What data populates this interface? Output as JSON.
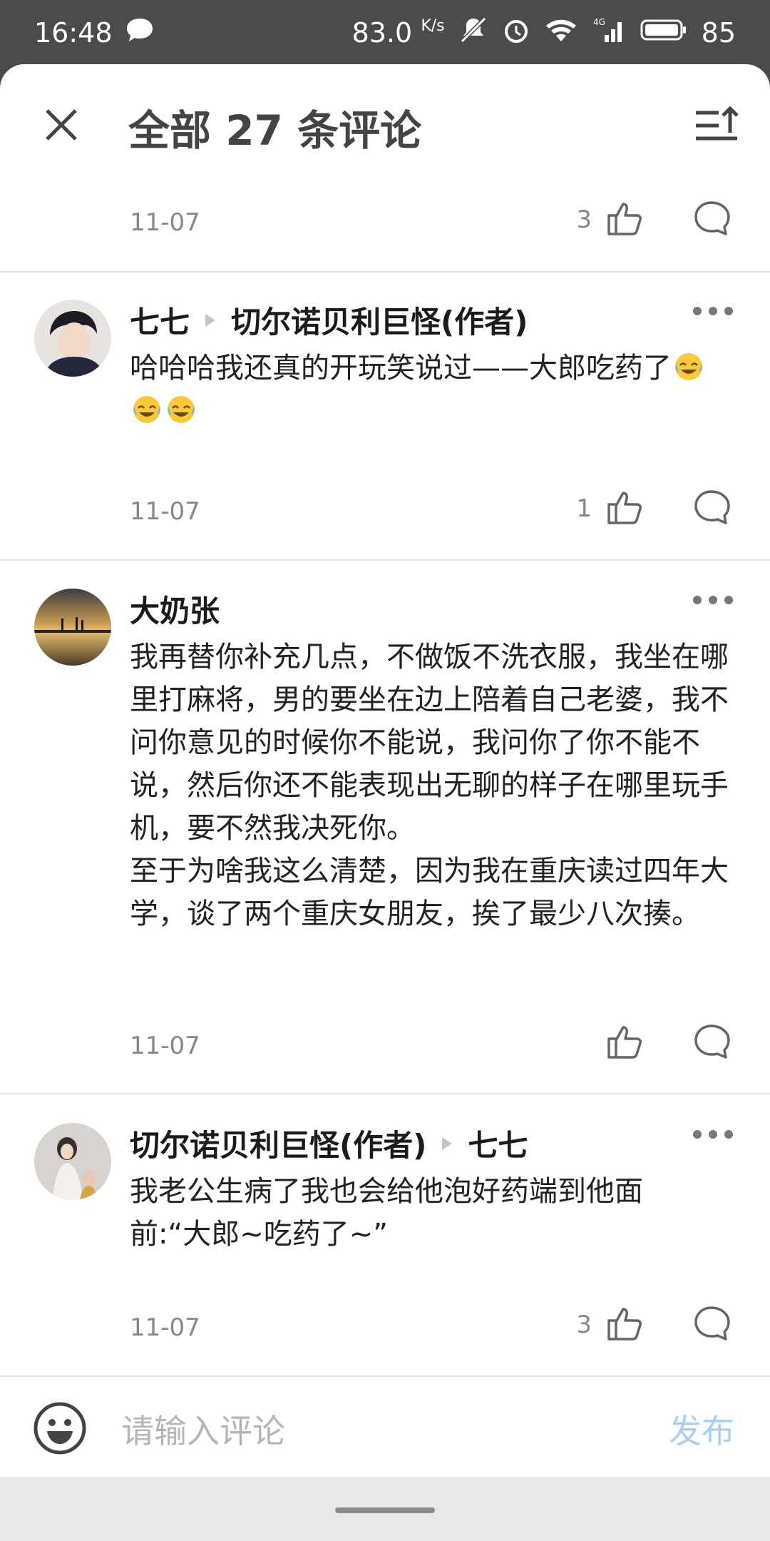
{
  "status_bar": {
    "time": "16:48",
    "speed": "83.0",
    "speed_unit": "K/s",
    "network": "4G",
    "battery": "85"
  },
  "header": {
    "title": "全部 27 条评论"
  },
  "top_partial": {
    "date": "11-07",
    "likes": "3"
  },
  "comments": [
    {
      "author": "七七",
      "reply_to": "切尔诺贝利巨怪(作者)",
      "text": "哈哈哈我还真的开玩笑说过——大郎吃药了",
      "emoji": "face-with-tears-of-joy-emoji",
      "date": "11-07",
      "likes": "1"
    },
    {
      "author": "大奶张",
      "text": "我再替你补充几点，不做饭不洗衣服，我坐在哪里打麻将，男的要坐在边上陪着自己老婆，我不问你意见的时候你不能说，我问你了你不能不说，然后你还不能表现出无聊的样子在哪里玩手机，要不然我决死你。\n至于为啥我这么清楚，因为我在重庆读过四年大学，谈了两个重庆女朋友，挨了最少八次揍。",
      "date": "11-07",
      "likes": ""
    },
    {
      "author": "切尔诺贝利巨怪(作者)",
      "reply_to": "七七",
      "text": "我老公生病了我也会给他泡好药端到他面前:“大郎~吃药了~”",
      "date": "11-07",
      "likes": "3"
    }
  ],
  "input_bar": {
    "placeholder": "请输入评论",
    "publish_label": "发布"
  },
  "colors": {
    "status_bg": "#4b4b4b",
    "publish": "#a7d0f2",
    "divider": "#e1e1e1"
  }
}
